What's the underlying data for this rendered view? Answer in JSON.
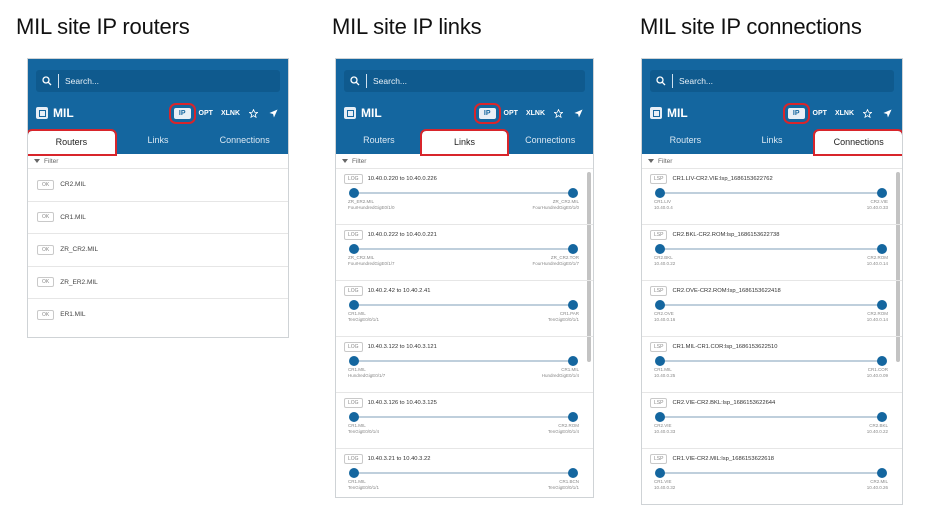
{
  "titles": {
    "routers": "MIL site IP routers",
    "links": "MIL site IP links",
    "connections": "MIL site IP connections"
  },
  "app": {
    "search_placeholder": "Search...",
    "site": "MIL",
    "layers": {
      "ip": "IP",
      "opt": "OPT",
      "xlnk": "XLNK"
    },
    "tabs": {
      "routers": "Routers",
      "links": "Links",
      "connections": "Connections"
    },
    "filter_label": "Filter",
    "icons": {
      "search": "search-icon",
      "star": "star-icon",
      "locate": "location-arrow-icon",
      "site": "site-icon",
      "filter": "caret-down-icon"
    }
  },
  "routers": {
    "items": [
      {
        "tag": "OK",
        "name": "CR2.MIL"
      },
      {
        "tag": "OK",
        "name": "CR1.MIL"
      },
      {
        "tag": "OK",
        "name": "ZR_CR2.MIL"
      },
      {
        "tag": "OK",
        "name": "ZR_ER2.MIL"
      },
      {
        "tag": "OK",
        "name": "ER1.MIL"
      }
    ]
  },
  "links": {
    "items": [
      {
        "tag": "LOG",
        "name": "10.40.0.220 to 10.40.0.226",
        "left_name": "ZR_ER2.MIL",
        "left_sub": "FourHundredGigE0/1/0",
        "right_name": "ZR_CR2.MIL",
        "right_sub": "FourHundredGigE0/1/0"
      },
      {
        "tag": "LOG",
        "name": "10.40.0.222 to 10.40.0.221",
        "left_name": "ZR_CR2.MIL",
        "left_sub": "FourHundredGigE0/1/7",
        "right_name": "ZR_CR2.TOR",
        "right_sub": "FourHundredGigE0/1/7"
      },
      {
        "tag": "LOG",
        "name": "10.40.2.42 to 10.40.2.41",
        "left_name": "CR1.MIL",
        "left_sub": "TenGigE0/0/1/1",
        "right_name": "CR1.PAR",
        "right_sub": "TenGigE0/0/1/1"
      },
      {
        "tag": "LOG",
        "name": "10.40.3.122 to 10.40.3.121",
        "left_name": "CR1.MIL",
        "left_sub": "HundredGigE0/1/7",
        "right_name": "CR1.MIL",
        "right_sub": "HundredGigE0/1/4"
      },
      {
        "tag": "LOG",
        "name": "10.40.3.126 to 10.40.3.125",
        "left_name": "CR1.MIL",
        "left_sub": "TenGigE0/0/1/4",
        "right_name": "CR2.ROM",
        "right_sub": "TenGigE0/0/1/4"
      },
      {
        "tag": "LOG",
        "name": "10.40.3.21 to 10.40.3.22",
        "left_name": "CR1.MIL",
        "left_sub": "TenGigE0/0/1/1",
        "right_name": "CR1.BCN",
        "right_sub": "TenGigE0/0/1/1"
      }
    ]
  },
  "connections": {
    "items": [
      {
        "tag": "LSP",
        "name": "CR1.LIV-CR2.VIE:lsp_1686153622762",
        "left_name": "CR1.LIV",
        "left_sub": "10.40.0.4",
        "right_name": "CR2.VIE",
        "right_sub": "10.40.0.33"
      },
      {
        "tag": "LSP",
        "name": "CR2.BKL-CR2.ROM:lsp_1686153622738",
        "left_name": "CR2.BKL",
        "left_sub": "10.40.0.22",
        "right_name": "CR2.ROM",
        "right_sub": "10.40.0.14"
      },
      {
        "tag": "LSP",
        "name": "CR2.OVE-CR2.ROM:lsp_1686153622418",
        "left_name": "CR2.OVE",
        "left_sub": "10.40.0.16",
        "right_name": "CR2.ROM",
        "right_sub": "10.40.0.14"
      },
      {
        "tag": "LSP",
        "name": "CR1.MIL-CR1.COR:lsp_1686153622510",
        "left_name": "CR1.MIL",
        "left_sub": "10.40.0.25",
        "right_name": "CR1.COR",
        "right_sub": "10.40.0.09"
      },
      {
        "tag": "LSP",
        "name": "CR2.VIE-CR2.BKL:lsp_1686153622644",
        "left_name": "CR2.VIE",
        "left_sub": "10.40.0.33",
        "right_name": "CR2.BKL",
        "right_sub": "10.40.0.22"
      },
      {
        "tag": "LSP",
        "name": "CR1.VIE-CR2.MIL:lsp_1686153622618",
        "left_name": "CR1.VIE",
        "left_sub": "10.40.0.32",
        "right_name": "CR2.MIL",
        "right_sub": "10.40.0.26"
      }
    ]
  }
}
